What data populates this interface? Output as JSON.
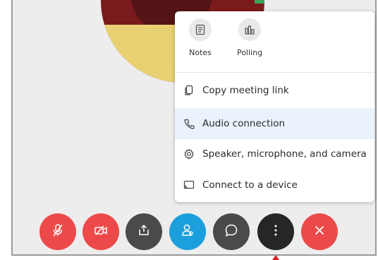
{
  "quick_actions": [
    {
      "label": "Notes",
      "icon": "notes-icon"
    },
    {
      "label": "Polling",
      "icon": "polling-icon"
    }
  ],
  "menu_items": [
    {
      "label": "Copy meeting link",
      "icon": "copy-icon",
      "highlighted": false
    },
    {
      "label": "Audio connection",
      "icon": "phone-icon",
      "highlighted": true
    },
    {
      "label": "Speaker, microphone, and camera",
      "icon": "settings-icon",
      "highlighted": false
    },
    {
      "label": "Connect to a device",
      "icon": "cast-icon",
      "highlighted": false
    }
  ],
  "control_bar": [
    {
      "name": "mute",
      "icon": "muted-microphone-icon",
      "color": "#ec4a4a"
    },
    {
      "name": "stop-video",
      "icon": "video-off-icon",
      "color": "#ec4a4a"
    },
    {
      "name": "share",
      "icon": "share-icon",
      "color": "#4a4a4a"
    },
    {
      "name": "participants",
      "icon": "participants-icon",
      "color": "#1c9fdd"
    },
    {
      "name": "chat",
      "icon": "chat-bubble-icon",
      "color": "#4a4a4a"
    },
    {
      "name": "more",
      "icon": "more-options-icon",
      "color": "#262626"
    },
    {
      "name": "leave",
      "icon": "close-icon",
      "color": "#ec4a4a"
    }
  ],
  "colors": {
    "accent_blue": "#1c9fdd",
    "danger_red": "#ec4a4a",
    "highlight": "#eaf3fb"
  }
}
